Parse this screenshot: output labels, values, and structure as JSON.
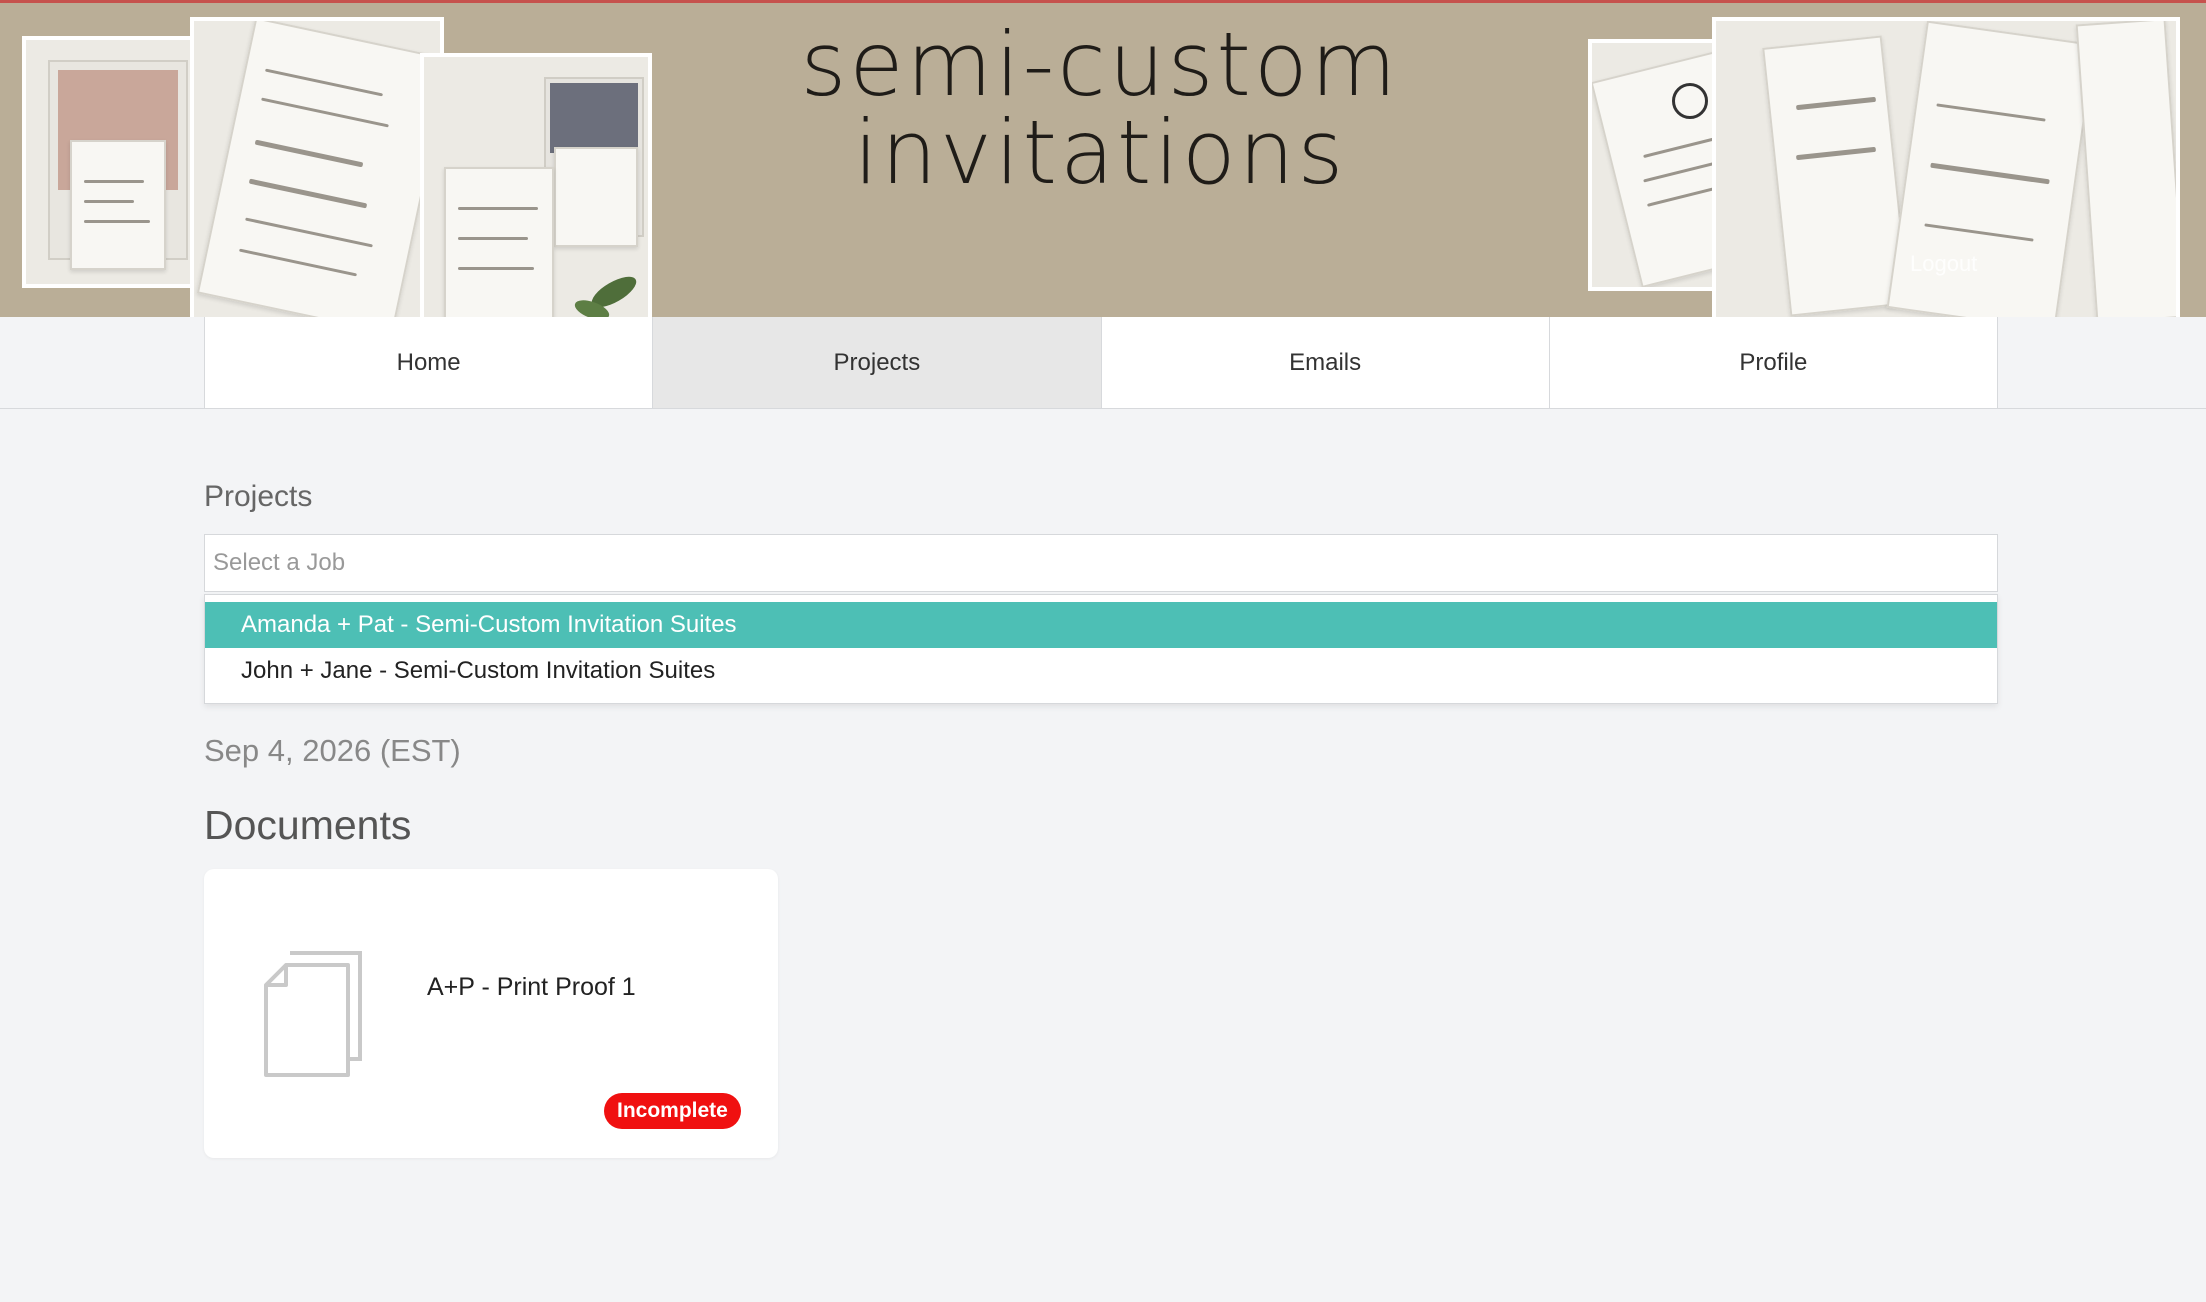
{
  "header": {
    "brand_line1": "semi-custom",
    "brand_line2": "invitations",
    "logout_label": "Logout"
  },
  "nav": {
    "tabs": [
      {
        "label": "Home"
      },
      {
        "label": "Projects"
      },
      {
        "label": "Emails"
      },
      {
        "label": "Profile"
      }
    ],
    "active": "Projects"
  },
  "projects": {
    "label": "Projects",
    "placeholder": "Select a Job",
    "options": [
      {
        "label": "Amanda + Pat - Semi-Custom Invitation Suites"
      },
      {
        "label": "John + Jane - Semi-Custom Invitation Suites"
      }
    ]
  },
  "event": {
    "date": "Sep 4, 2026 (EST)"
  },
  "documents": {
    "title": "Documents",
    "items": [
      {
        "name": "A+P - Print Proof 1",
        "status": "Incomplete",
        "icon": "document-icon"
      }
    ]
  },
  "colors": {
    "banner": "#baae97",
    "accent": "#4dbfb5",
    "status_incomplete": "#f01010",
    "top_border": "#c6524d"
  }
}
